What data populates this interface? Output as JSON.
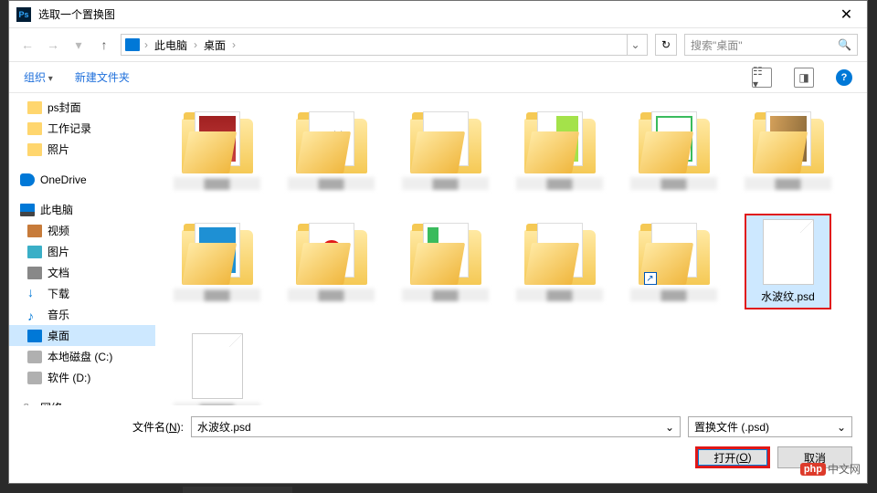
{
  "window": {
    "title": "选取一个置换图"
  },
  "breadcrumb": {
    "root": "此电脑",
    "current": "桌面"
  },
  "search": {
    "placeholder": "搜索\"桌面\""
  },
  "toolbar": {
    "organize": "组织",
    "newfolder": "新建文件夹"
  },
  "sidebar": {
    "ps_cover": "ps封面",
    "work_log": "工作记录",
    "photos": "照片",
    "onedrive": "OneDrive",
    "this_pc": "此电脑",
    "video": "视频",
    "pictures": "图片",
    "documents": "文档",
    "downloads": "下载",
    "music": "音乐",
    "desktop": "桌面",
    "disk_c": "本地磁盘 (C:)",
    "disk_d": "软件 (D:)",
    "network": "网络"
  },
  "files": {
    "selected_label": "水波纹.psd"
  },
  "filename": {
    "label_pre": "文件名(",
    "label_key": "N",
    "label_post": "):",
    "value": "水波纹.psd"
  },
  "filter": {
    "value": "置换文件 (.psd)"
  },
  "buttons": {
    "open_pre": "打开(",
    "open_key": "O",
    "open_post": ")",
    "cancel": "取消"
  },
  "watermark": {
    "badge": "php",
    "text": "中文网"
  }
}
